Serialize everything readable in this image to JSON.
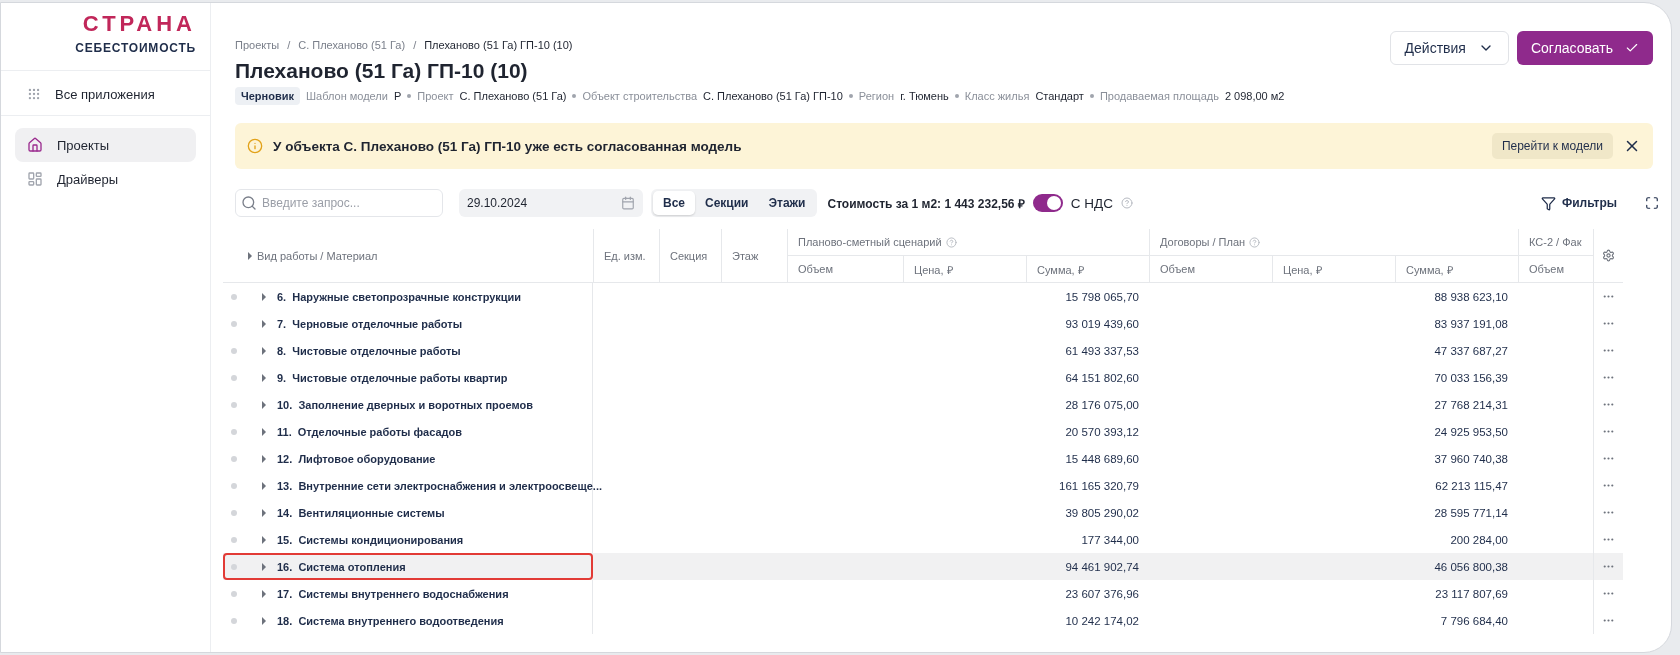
{
  "logo": {
    "wordmark": "СТРАНА",
    "subtitle": "СЕБЕСТОИМОСТЬ"
  },
  "sidebar": {
    "items": [
      {
        "kind": "apps",
        "label": "Все приложения",
        "selected": false
      },
      {
        "kind": "projects",
        "label": "Проекты",
        "selected": true
      },
      {
        "kind": "drivers",
        "label": "Драйверы",
        "selected": false
      }
    ]
  },
  "breadcrumbs": [
    "Проекты",
    "С. Плеханово (51 Га)",
    "Плеханово (51 Га) ГП-10 (10)"
  ],
  "breadcrumb_separators": [
    "/",
    "/"
  ],
  "title": "Плеханово (51 Га) ГП-10 (10)",
  "status": "Черновик",
  "meta": [
    {
      "label": "Шаблон модели",
      "value": "Р"
    },
    {
      "label": "Проект",
      "value": "С. Плеханово (51 Га)"
    },
    {
      "label": "Объект строительства",
      "value": "С. Плеханово (51 Га) ГП-10"
    },
    {
      "label": "Регион",
      "value": "г. Тюмень"
    },
    {
      "label": "Класс жилья",
      "value": "Стандарт"
    },
    {
      "label": "Продаваемая площадь",
      "value": "2 098,00 м2"
    }
  ],
  "actions": {
    "menu": "Действия",
    "approve": "Согласовать"
  },
  "alert": {
    "text": "У объекта С. Плеханово (51 Га) ГП-10 уже есть согласованная модель",
    "button": "Перейти к модели"
  },
  "toolbar": {
    "search_placeholder": "Введите запрос...",
    "date": "29.10.2024",
    "segments": [
      {
        "label": "Все",
        "selected": true
      },
      {
        "label": "Секции",
        "selected": false
      },
      {
        "label": "Этажи",
        "selected": false
      }
    ],
    "cost": "Стоимость за 1 м2: 1 443 232,56 ₽",
    "vat": {
      "label": "С НДС",
      "on": true
    },
    "filters": "Фильтры"
  },
  "table": {
    "name_column": "Вид работы / Материал",
    "columns": [
      "Ед. изм.",
      "Секция",
      "Этаж"
    ],
    "groups": [
      {
        "title": "Планово-сметный сценарий",
        "columns": [
          "Объем",
          "Цена, ₽",
          "Сумма, ₽"
        ]
      },
      {
        "title": "Договоры / План",
        "columns": [
          "Объем",
          "Цена, ₽",
          "Сумма, ₽"
        ]
      },
      {
        "title": "КС-2 / Фак",
        "columns": [
          "Объем"
        ]
      }
    ],
    "rows": [
      {
        "name": "6.  Наружные светопрозрачные конструкции",
        "plan_sum": "15 798 065,70",
        "contract_sum": "88 938 623,10",
        "selected": false
      },
      {
        "name": "7.  Черновые отделочные работы",
        "plan_sum": "93 019 439,60",
        "contract_sum": "83 937 191,08",
        "selected": false
      },
      {
        "name": "8.  Чистовые отделочные работы",
        "plan_sum": "61 493 337,53",
        "contract_sum": "47 337 687,27",
        "selected": false
      },
      {
        "name": "9.  Чистовые отделочные работы квартир",
        "plan_sum": "64 151 802,60",
        "contract_sum": "70 033 156,39",
        "selected": false
      },
      {
        "name": "10.  Заполнение дверных и воротных проемов",
        "plan_sum": "28 176 075,00",
        "contract_sum": "27 768 214,31",
        "selected": false
      },
      {
        "name": "11.  Отделочные работы фасадов",
        "plan_sum": "20 570 393,12",
        "contract_sum": "24 925 953,50",
        "selected": false
      },
      {
        "name": "12.  Лифтовое оборудование",
        "plan_sum": "15 448 689,60",
        "contract_sum": "37 960 740,38",
        "selected": false
      },
      {
        "name": "13.  Внутренние сети электроснабжения и электроосвеще...",
        "plan_sum": "161 165 320,79",
        "contract_sum": "62 213 115,47",
        "selected": false
      },
      {
        "name": "14.  Вентиляционные системы",
        "plan_sum": "39 805 290,02",
        "contract_sum": "28 595 771,14",
        "selected": false
      },
      {
        "name": "15.  Системы кондиционирования",
        "plan_sum": "177 344,00",
        "contract_sum": "200 284,00",
        "selected": false
      },
      {
        "name": "16.  Система отопления",
        "plan_sum": "94 461 902,74",
        "contract_sum": "46 056 800,38",
        "selected": true
      },
      {
        "name": "17.  Системы внутреннего водоснабжения",
        "plan_sum": "23 607 376,96",
        "contract_sum": "23 117 807,69",
        "selected": false
      },
      {
        "name": "18.  Система внутреннего водоотведения",
        "plan_sum": "10 242 174,02",
        "contract_sum": "7 796 684,40",
        "selected": false
      }
    ]
  }
}
